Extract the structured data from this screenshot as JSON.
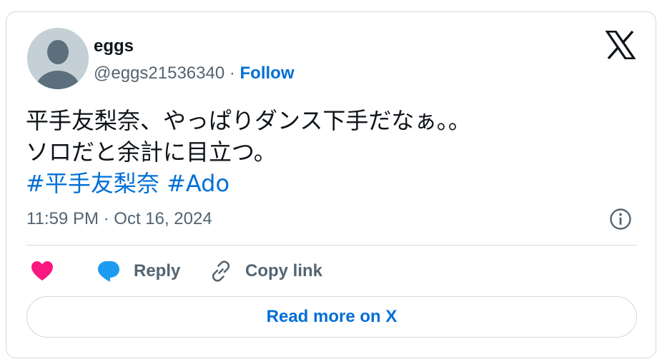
{
  "author": {
    "name": "eggs",
    "handle": "@eggs21536340",
    "separator": " · ",
    "follow_label": "Follow"
  },
  "tweet": {
    "line1": "平手友梨奈、やっぱりダンス下手だなぁ。。",
    "line2": "ソロだと余計に目立つ。",
    "hashtags": [
      "#平手友梨奈",
      "#Ado"
    ],
    "timestamp": "11:59 PM · Oct 16, 2024"
  },
  "actions": {
    "like_icon": "heart-icon",
    "reply_label": "Reply",
    "reply_icon": "speech-bubble-icon",
    "copy_label": "Copy link",
    "copy_icon": "link-icon"
  },
  "footer": {
    "read_more_label": "Read more on X"
  },
  "colors": {
    "accent": "#006fd6",
    "heart": "#f91880",
    "reply_bubble": "#1d9bf0",
    "muted": "#536471",
    "text": "#0f1419",
    "border": "#cfd9de"
  }
}
